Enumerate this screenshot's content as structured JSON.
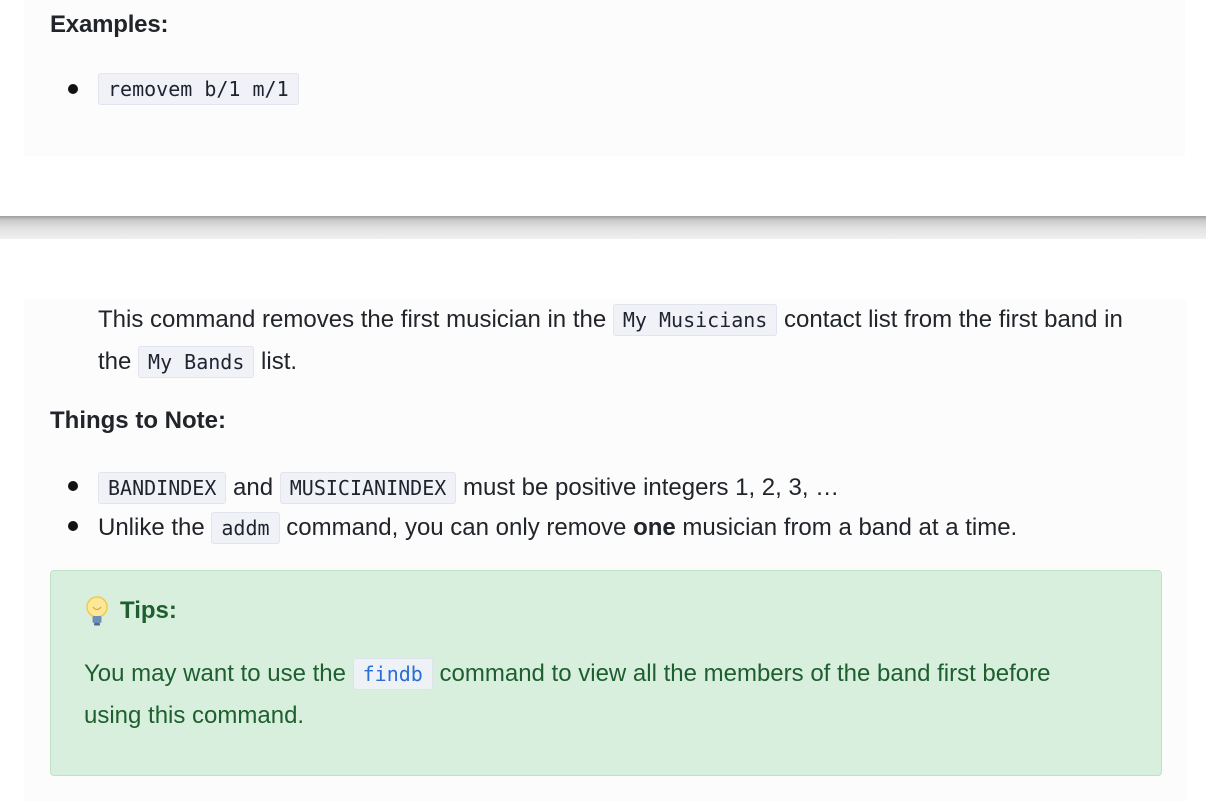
{
  "examples": {
    "heading": "Examples:",
    "items": [
      "removem b/1 m/1"
    ]
  },
  "description": {
    "part1": "This command removes the first musician in the ",
    "code1": "My Musicians",
    "part2": " contact list from the first band in the ",
    "code2": "My Bands",
    "part3": " list."
  },
  "notes": {
    "heading": "Things to Note:",
    "item1": {
      "code1": "BANDINDEX",
      "text1": " and ",
      "code2": "MUSICIANINDEX",
      "text2": " must be positive integers 1, 2, 3, …"
    },
    "item2": {
      "text1": "Unlike the ",
      "code1": "addm",
      "text2": " command, you can only remove ",
      "bold": "one",
      "text3": " musician from a band at a time."
    }
  },
  "tips": {
    "icon": "lightbulb-icon",
    "heading": "Tips:",
    "text1": "You may want to use the ",
    "code": "findb",
    "text2": " command to view all the members of the band first before using this command.",
    "colors": {
      "background": "#d8efdd",
      "text": "#1d5f2e",
      "code": "#2a6dd6"
    }
  }
}
